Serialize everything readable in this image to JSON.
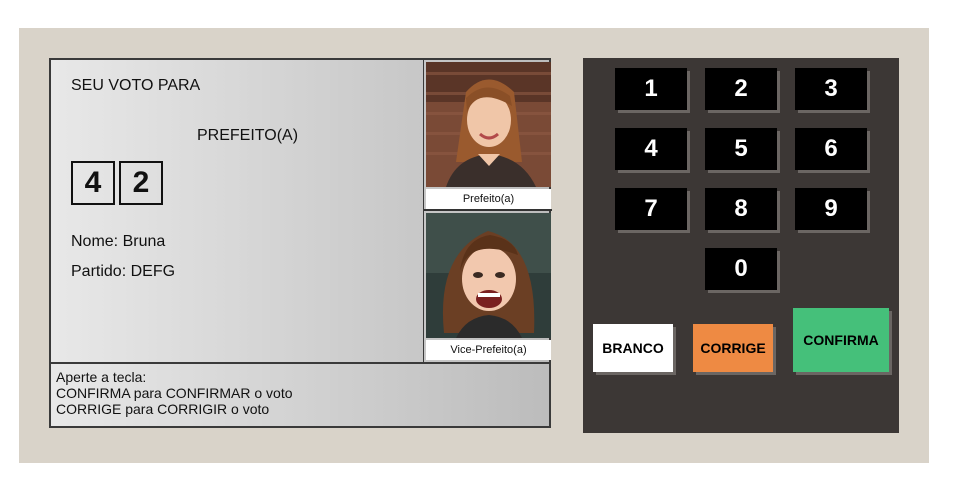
{
  "screen": {
    "vote_for": "SEU VOTO PARA",
    "office": "PREFEITO(A)",
    "digits": [
      "4",
      "2"
    ],
    "name_line": "Nome: Bruna",
    "party_line": "Partido: DEFG",
    "photos": [
      {
        "caption": "Prefeito(a)"
      },
      {
        "caption": "Vice-Prefeito(a)"
      }
    ],
    "instructions": [
      "Aperte a tecla:",
      "CONFIRMA para CONFIRMAR o voto",
      "CORRIGE para CORRIGIR o voto"
    ]
  },
  "keypad": {
    "keys": [
      "1",
      "2",
      "3",
      "4",
      "5",
      "6",
      "7",
      "8",
      "9",
      "0"
    ],
    "blank_label": "BRANCO",
    "correct_label": "CORRIGE",
    "confirm_label": "CONFIRMA"
  },
  "colors": {
    "cabinet": "#d9d3c9",
    "keypad_bg": "#3c3735",
    "key": "#000000",
    "blank": "#ffffff",
    "correct": "#ee8a43",
    "confirm": "#45c07a"
  }
}
